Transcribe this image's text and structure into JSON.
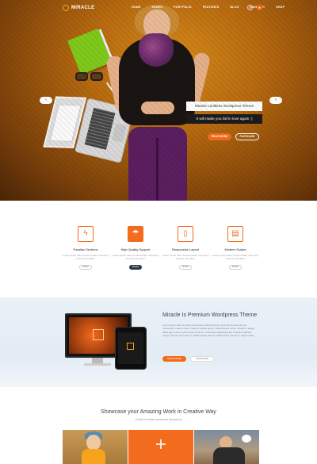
{
  "brand": {
    "name": "MIRACLE",
    "accent": "#f36b1c"
  },
  "nav": {
    "items": [
      "HOME",
      "PAGES",
      "PORTFOLIO",
      "FEATURES",
      "BLOG",
      "CONTACT",
      "SHOP"
    ],
    "icons": [
      "search-icon",
      "cart-icon"
    ]
  },
  "hero": {
    "caption_1": "Miracle Limitless Wordpress Theme",
    "caption_2": "It will make you fall in love again :)",
    "button_primary": "READ MORE",
    "button_secondary": "PURCHASE",
    "prev_label": "‹",
    "next_label": "›"
  },
  "features": [
    {
      "icon": "lightning-icon",
      "title": "Parallax Sections",
      "text": "Lorem ipsum dolor sit amet diam nonummy sit amet sed diam.",
      "button": "MORE"
    },
    {
      "icon": "umbrella-icon",
      "title": "High Quality Support",
      "text": "Lorem ipsum dolor sit amet diam nonummy sit amet sed diam.",
      "button": "MORE"
    },
    {
      "icon": "tablet-icon",
      "title": "Responsive Layout",
      "text": "Lorem ipsum dolor sit amet diam nonummy sit amet sed diam.",
      "button": "MORE"
    },
    {
      "icon": "book-icon",
      "title": "Modern Scripts",
      "text": "Lorem ipsum dolor sit amet diam nonummy sit amet sed diam.",
      "button": "MORE"
    }
  ],
  "premium": {
    "title": "Miracle Is Premium Wordpress Theme",
    "text": "Lorem ipsum dolor sit amet consectetur adipiscing elit. Nunc ornare sed elit sed consectetur mauris metus. Nulla id magna auctor. Pellentesque metus. Mauris in augue tellus eget. Lorem ipsum dolor sit amet, consectetur adipiscing elit. Praesent dapibus metus. Aenean nec lorem in. Pellentesque laoreet mattis ornare. Donec in sapien tellus.",
    "button_primary": "READ MORE",
    "button_secondary": "PURCHASE"
  },
  "showcase": {
    "title": "Showcase your Amazing Work in Creative Way",
    "subtitle": "Ceritas est etiam processus dynamicus"
  }
}
